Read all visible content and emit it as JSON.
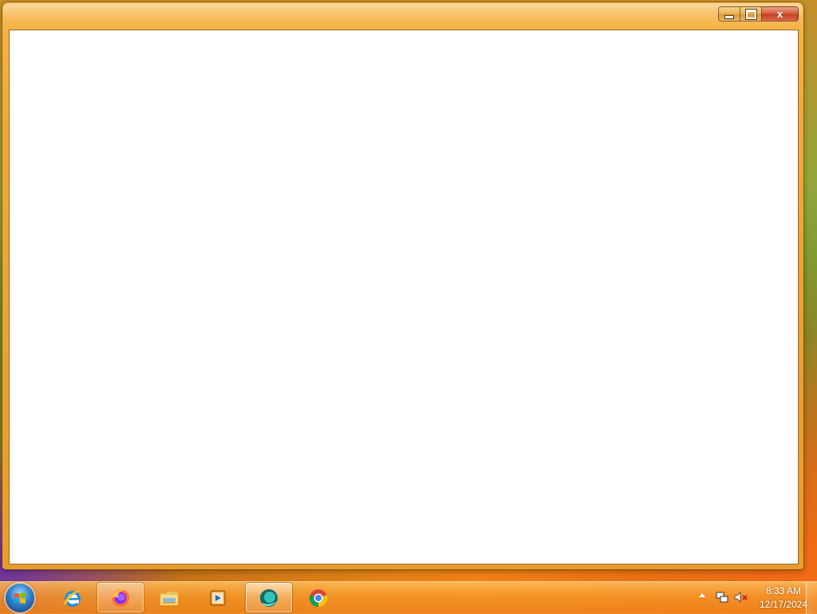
{
  "window": {
    "caption_buttons": {
      "minimize": "minimize-icon",
      "maximize": "maximize-icon",
      "close_label": "x"
    }
  },
  "taskbar": {
    "start_button": "windows-start-orb",
    "pinned_apps": [
      {
        "name": "Internet Explorer",
        "icon": "internet-explorer-icon",
        "state": "pinned"
      },
      {
        "name": "Firefox",
        "icon": "firefox-icon",
        "state": "running"
      },
      {
        "name": "File Explorer",
        "icon": "folder-icon",
        "state": "pinned"
      },
      {
        "name": "Media Player",
        "icon": "media-player-icon",
        "state": "pinned"
      },
      {
        "name": "Active App",
        "icon": "teal-app-icon",
        "state": "active"
      },
      {
        "name": "Chrome",
        "icon": "chrome-icon",
        "state": "pinned"
      }
    ],
    "tray": {
      "overflow_icon": "chevron-up-icon",
      "network_icon": "network-icon",
      "volume_icon": "volume-muted-icon"
    },
    "clock": {
      "time": "8:33 AM",
      "date": "12/17/2024"
    }
  },
  "colors": {
    "window_frame": "#eba335",
    "taskbar": "#f08a1e",
    "client_background": "#ffffff",
    "close_button": "#c4401f"
  }
}
